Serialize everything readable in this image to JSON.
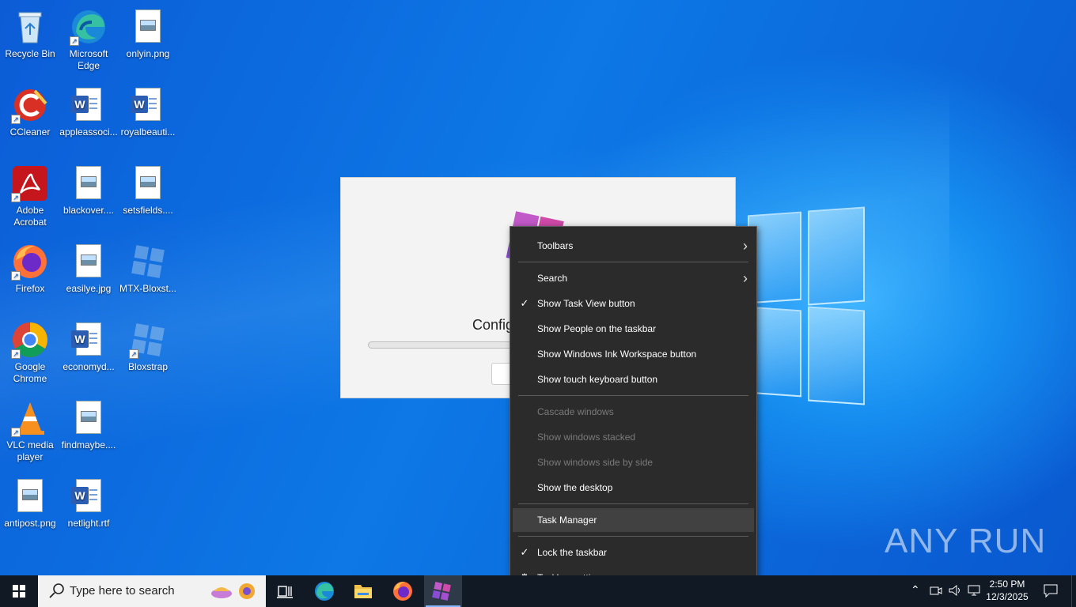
{
  "desktop_icons": [
    {
      "label": "Recycle Bin",
      "icon": "recycle-bin-icon"
    },
    {
      "label": "Microsoft Edge",
      "icon": "edge-icon"
    },
    {
      "label": "onlyin.png",
      "icon": "image-file-icon"
    },
    {
      "label": "CCleaner",
      "icon": "ccleaner-icon"
    },
    {
      "label": "appleassoci...",
      "icon": "word-doc-icon"
    },
    {
      "label": "royalbeauti...",
      "icon": "word-doc-icon"
    },
    {
      "label": "Adobe Acrobat",
      "icon": "acrobat-icon"
    },
    {
      "label": "blackover....",
      "icon": "image-file-icon"
    },
    {
      "label": "setsfields....",
      "icon": "image-file-icon"
    },
    {
      "label": "Firefox",
      "icon": "firefox-icon"
    },
    {
      "label": "easilye.jpg",
      "icon": "image-file-icon"
    },
    {
      "label": "MTX-Bloxst...",
      "icon": "bloxstrap-icon"
    },
    {
      "label": "Google Chrome",
      "icon": "chrome-icon"
    },
    {
      "label": "economyd...",
      "icon": "word-doc-icon"
    },
    {
      "label": "Bloxstrap",
      "icon": "bloxstrap-icon"
    },
    {
      "label": "VLC media player",
      "icon": "vlc-icon"
    },
    {
      "label": "findmaybe....",
      "icon": "image-file-icon"
    },
    {
      "label": "antipost.png",
      "icon": "image-file-icon"
    },
    {
      "label": "netlight.rtf",
      "icon": "word-doc-icon"
    }
  ],
  "dialog": {
    "title": "Configuring"
  },
  "context_menu": {
    "items": [
      {
        "label": "Toolbars",
        "submenu": true
      },
      {
        "label": "Search",
        "submenu": true
      },
      {
        "label": "Show Task View button",
        "checked": true
      },
      {
        "label": "Show People on the taskbar"
      },
      {
        "label": "Show Windows Ink Workspace button"
      },
      {
        "label": "Show touch keyboard button"
      },
      {
        "label": "Cascade windows",
        "disabled": true
      },
      {
        "label": "Show windows stacked",
        "disabled": true
      },
      {
        "label": "Show windows side by side",
        "disabled": true
      },
      {
        "label": "Show the desktop"
      },
      {
        "label": "Task Manager",
        "highlighted": true
      },
      {
        "label": "Lock the taskbar",
        "checked": true
      },
      {
        "label": "Taskbar settings",
        "icon": "gear-icon"
      }
    ]
  },
  "watermark": "ANY RUN",
  "taskbar": {
    "search_placeholder": "Type here to search",
    "pinned": [
      "task-view-icon",
      "edge-icon",
      "file-explorer-icon",
      "firefox-icon",
      "bloxstrap-icon"
    ],
    "clock_time": "2:50 PM",
    "clock_date": "12/3/2025"
  },
  "colors": {
    "accent": "#86b7ff",
    "menu_bg": "#2b2b2b",
    "taskbar_bg": "#111a24"
  }
}
